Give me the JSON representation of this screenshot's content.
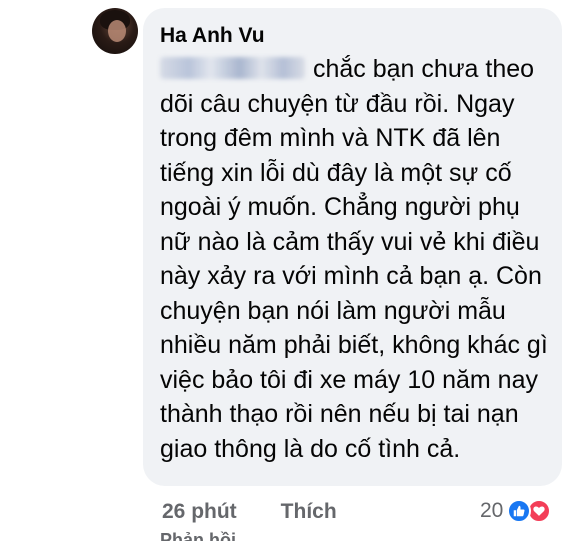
{
  "comment": {
    "author": "Ha Anh Vu",
    "text": "chắc bạn chưa theo dõi câu chuyện từ đầu rồi. Ngay trong đêm mình và NTK đã lên tiếng xin lỗi dù đây là một sự cố ngoài ý muốn. Chẳng người phụ nữ nào là cảm thấy vui vẻ khi điều này xảy ra với mình cả bạn ạ. Còn chuyện bạn nói làm người mẫu nhiều năm phải biết, không khác gì việc bảo tôi đi xe máy 10 năm nay thành thạo rồi nên nếu bị tai nạn giao thông là do cố tình cả.",
    "mention_icon": "blurred-mention",
    "time": "26 phút",
    "like_action": "Thích",
    "reaction_count": "20",
    "reaction_icons": [
      "like-icon",
      "love-icon"
    ],
    "reply_peek": "Phản hồi"
  },
  "colors": {
    "bubble": "#f0f2f5",
    "like": "#1877f2",
    "love": "#f33e58",
    "meta": "#65676b"
  }
}
